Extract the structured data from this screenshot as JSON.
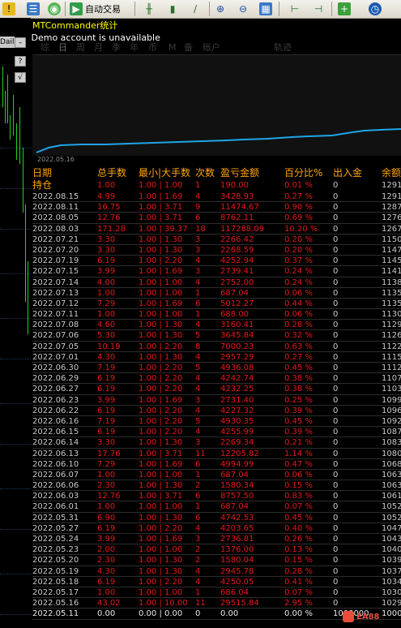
{
  "toolbar": {
    "auto_trade_label": "自动交易",
    "icons": [
      "warning-icon",
      "profile-icon",
      "orb-icon",
      "auto-trade-icon",
      "bar-chart-icon",
      "candle-chart-icon",
      "line-chart-icon",
      "zoom-in-icon",
      "zoom-out-icon",
      "tile-windows-icon",
      "shift-chart-icon",
      "autoscroll-icon",
      "new-indicator-icon",
      "periods-clock-icon"
    ]
  },
  "left_strip": {
    "period_label": "Daily",
    "buttons": [
      "?",
      "√"
    ],
    "vertical_text": "1.0 00 6X 1 F"
  },
  "window": {
    "title": "MTCommander统计",
    "account_line": "00010 Demo account is unavailable",
    "tabs": [
      "综",
      "日",
      "周",
      "月",
      "季",
      "年",
      "币",
      "M",
      "备",
      "账户",
      "轨迹"
    ],
    "active_tab": "日",
    "chart_start_date": "2022.05.16"
  },
  "table": {
    "headers": {
      "date": "日期",
      "row0": "持仓",
      "total": "总手数",
      "minmax": "最小|大手数",
      "count": "次数",
      "pnl": "盈亏金额",
      "pct": "百分比%",
      "flow": "出入金",
      "balance": "余额"
    },
    "rows": [
      {
        "date": "持仓",
        "total": "1.00",
        "minmax": "1.00 | 1.00",
        "count": "1",
        "pnl": "190.00",
        "pct": "0.01 %",
        "flow": "0",
        "bal": "1291"
      },
      {
        "date": "2022.08.15",
        "total": "4.99",
        "minmax": "1.00 | 1.69",
        "count": "4",
        "pnl": "3428.93",
        "pct": "0.27 %",
        "flow": "0",
        "bal": "1291"
      },
      {
        "date": "2022.08.11",
        "total": "16.75",
        "minmax": "1.00 | 3.71",
        "count": "9",
        "pnl": "11474.67",
        "pct": "0.90 %",
        "flow": "0",
        "bal": "1287"
      },
      {
        "date": "2022.08.05",
        "total": "12.76",
        "minmax": "1.00 | 3.71",
        "count": "6",
        "pnl": "8762.11",
        "pct": "0.69 %",
        "flow": "0",
        "bal": "1276"
      },
      {
        "date": "2022.08.03",
        "total": "171.28",
        "minmax": "1.00 | 39.37",
        "count": "18",
        "pnl": "117288.09",
        "pct": "10.20 %",
        "flow": "0",
        "bal": "1267"
      },
      {
        "date": "2022.07.21",
        "total": "3.30",
        "minmax": "1.00 | 1.30",
        "count": "3",
        "pnl": "2266.42",
        "pct": "0.20 %",
        "flow": "0",
        "bal": "1150"
      },
      {
        "date": "2022.07.20",
        "total": "3.30",
        "minmax": "1.00 | 1.30",
        "count": "3",
        "pnl": "2268.59",
        "pct": "0.20 %",
        "flow": "0",
        "bal": "1147"
      },
      {
        "date": "2022.07.19",
        "total": "6.19",
        "minmax": "1.00 | 2.20",
        "count": "4",
        "pnl": "4252.94",
        "pct": "0.37 %",
        "flow": "0",
        "bal": "1145"
      },
      {
        "date": "2022.07.15",
        "total": "3.99",
        "minmax": "1.00 | 1.69",
        "count": "3",
        "pnl": "2739.41",
        "pct": "0.24 %",
        "flow": "0",
        "bal": "1141"
      },
      {
        "date": "2022.07.14",
        "total": "4.00",
        "minmax": "1.00 | 1.00",
        "count": "4",
        "pnl": "2752.00",
        "pct": "0.24 %",
        "flow": "0",
        "bal": "1138"
      },
      {
        "date": "2022.07.13",
        "total": "1.00",
        "minmax": "1.00 | 1.00",
        "count": "1",
        "pnl": "687.04",
        "pct": "0.06 %",
        "flow": "0",
        "bal": "1135"
      },
      {
        "date": "2022.07.12",
        "total": "7.29",
        "minmax": "1.00 | 1.69",
        "count": "6",
        "pnl": "5012.27",
        "pct": "0.44 %",
        "flow": "0",
        "bal": "1135"
      },
      {
        "date": "2022.07.11",
        "total": "1.00",
        "minmax": "1.00 | 1.00",
        "count": "1",
        "pnl": "688.00",
        "pct": "0.06 %",
        "flow": "0",
        "bal": "1130"
      },
      {
        "date": "2022.07.08",
        "total": "4.60",
        "minmax": "1.00 | 1.30",
        "count": "4",
        "pnl": "3160.41",
        "pct": "0.28 %",
        "flow": "0",
        "bal": "1129"
      },
      {
        "date": "2022.07.06",
        "total": "5.30",
        "minmax": "1.00 | 1.30",
        "count": "5",
        "pnl": "3645.84",
        "pct": "0.32 %",
        "flow": "0",
        "bal": "1126"
      },
      {
        "date": "2022.07.05",
        "total": "10.19",
        "minmax": "1.00 | 2.20",
        "count": "8",
        "pnl": "7000.23",
        "pct": "0.63 %",
        "flow": "0",
        "bal": "1122"
      },
      {
        "date": "2022.07.01",
        "total": "4.30",
        "minmax": "1.00 | 1.30",
        "count": "4",
        "pnl": "2957.29",
        "pct": "0.27 %",
        "flow": "0",
        "bal": "1115"
      },
      {
        "date": "2022.06.30",
        "total": "7.19",
        "minmax": "1.00 | 2.20",
        "count": "5",
        "pnl": "4936.08",
        "pct": "0.45 %",
        "flow": "0",
        "bal": "1112"
      },
      {
        "date": "2022.06.29",
        "total": "6.19",
        "minmax": "1.00 | 2.20",
        "count": "4",
        "pnl": "4242.74",
        "pct": "0.38 %",
        "flow": "0",
        "bal": "1107"
      },
      {
        "date": "2022.06.27",
        "total": "6.19",
        "minmax": "1.00 | 2.20",
        "count": "4",
        "pnl": "4232.25",
        "pct": "0.38 %",
        "flow": "0",
        "bal": "1103"
      },
      {
        "date": "2022.06.23",
        "total": "3.99",
        "minmax": "1.00 | 1.69",
        "count": "3",
        "pnl": "2731.40",
        "pct": "0.25 %",
        "flow": "0",
        "bal": "1099"
      },
      {
        "date": "2022.06.22",
        "total": "6.19",
        "minmax": "1.00 | 2.20",
        "count": "4",
        "pnl": "4227.32",
        "pct": "0.39 %",
        "flow": "0",
        "bal": "1096"
      },
      {
        "date": "2022.06.16",
        "total": "7.19",
        "minmax": "1.00 | 2.20",
        "count": "5",
        "pnl": "4930.35",
        "pct": "0.45 %",
        "flow": "0",
        "bal": "1092"
      },
      {
        "date": "2022.06.15",
        "total": "6.19",
        "minmax": "1.00 | 2.20",
        "count": "4",
        "pnl": "4255.99",
        "pct": "0.39 %",
        "flow": "0",
        "bal": "1087"
      },
      {
        "date": "2022.06.14",
        "total": "3.30",
        "minmax": "1.00 | 1.30",
        "count": "3",
        "pnl": "2269.34",
        "pct": "0.21 %",
        "flow": "0",
        "bal": "1083"
      },
      {
        "date": "2022.06.13",
        "total": "17.76",
        "minmax": "1.00 | 3.71",
        "count": "11",
        "pnl": "12205.82",
        "pct": "1.14 %",
        "flow": "0",
        "bal": "1080"
      },
      {
        "date": "2022.06.10",
        "total": "7.29",
        "minmax": "1.00 | 1.69",
        "count": "6",
        "pnl": "4994.99",
        "pct": "0.47 %",
        "flow": "0",
        "bal": "1068"
      },
      {
        "date": "2022.06.07",
        "total": "1.00",
        "minmax": "1.00 | 1.00",
        "count": "1",
        "pnl": "687.04",
        "pct": "0.06 %",
        "flow": "0",
        "bal": "1063"
      },
      {
        "date": "2022.06.06",
        "total": "2.30",
        "minmax": "1.00 | 1.30",
        "count": "2",
        "pnl": "1580.34",
        "pct": "0.15 %",
        "flow": "0",
        "bal": "1063"
      },
      {
        "date": "2022.06.03",
        "total": "12.76",
        "minmax": "1.00 | 3.71",
        "count": "6",
        "pnl": "8757.50",
        "pct": "0.83 %",
        "flow": "0",
        "bal": "1061"
      },
      {
        "date": "2022.06.01",
        "total": "1.00",
        "minmax": "1.00 | 1.00",
        "count": "1",
        "pnl": "687.04",
        "pct": "0.07 %",
        "flow": "0",
        "bal": "1052"
      },
      {
        "date": "2022.05.31",
        "total": "6.90",
        "minmax": "1.00 | 1.30",
        "count": "6",
        "pnl": "4742.53",
        "pct": "0.45 %",
        "flow": "0",
        "bal": "1052"
      },
      {
        "date": "2022.05.27",
        "total": "6.19",
        "minmax": "1.00 | 2.20",
        "count": "4",
        "pnl": "4203.65",
        "pct": "0.40 %",
        "flow": "0",
        "bal": "1047"
      },
      {
        "date": "2022.05.24",
        "total": "3.99",
        "minmax": "1.00 | 1.69",
        "count": "3",
        "pnl": "2736.81",
        "pct": "0.26 %",
        "flow": "0",
        "bal": "1043"
      },
      {
        "date": "2022.05.23",
        "total": "2.00",
        "minmax": "1.00 | 1.00",
        "count": "2",
        "pnl": "1376.00",
        "pct": "0.13 %",
        "flow": "0",
        "bal": "1040"
      },
      {
        "date": "2022.05.20",
        "total": "2.30",
        "minmax": "1.00 | 1.30",
        "count": "2",
        "pnl": "1580.04",
        "pct": "0.15 %",
        "flow": "0",
        "bal": "1039"
      },
      {
        "date": "2022.05.19",
        "total": "4.30",
        "minmax": "1.00 | 1.30",
        "count": "4",
        "pnl": "2945.78",
        "pct": "0.28 %",
        "flow": "0",
        "bal": "1037"
      },
      {
        "date": "2022.05.18",
        "total": "6.19",
        "minmax": "1.00 | 2.20",
        "count": "4",
        "pnl": "4250.05",
        "pct": "0.41 %",
        "flow": "0",
        "bal": "1034"
      },
      {
        "date": "2022.05.17",
        "total": "1.00",
        "minmax": "1.00 | 1.00",
        "count": "1",
        "pnl": "686.04",
        "pct": "0.07 %",
        "flow": "0",
        "bal": "1030"
      },
      {
        "date": "2022.05.16",
        "total": "43.02",
        "minmax": "1.00 | 10.00",
        "count": "11",
        "pnl": "29515.84",
        "pct": "2.95 %",
        "flow": "0",
        "bal": "1029"
      },
      {
        "date": "2022.05.11",
        "total": "0.00",
        "minmax": "0.00 | 0.00",
        "count": "0",
        "pnl": "0.00",
        "pct": "0.00 %",
        "flow": "1000000",
        "bal": "1000"
      }
    ]
  },
  "watermark": "EA88",
  "colors": {
    "curve": "#1fa5e8",
    "header": "#ffa500",
    "loss_profit": "#e81818",
    "title": "#ffff00",
    "candles": "#1fd31f"
  }
}
